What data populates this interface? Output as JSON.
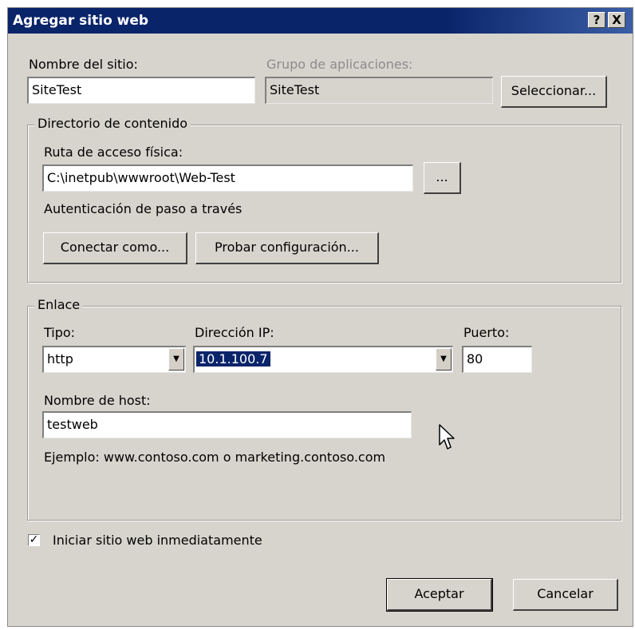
{
  "window": {
    "title": "Agregar sitio web",
    "help_label": "?",
    "close_label": "X"
  },
  "site": {
    "name_label": "Nombre del sitio:",
    "name_value": "SiteTest",
    "app_pool_label": "Grupo de aplicaciones:",
    "app_pool_value": "SiteTest",
    "select_button": "Seleccionar..."
  },
  "content_dir": {
    "group_title": "Directorio de contenido",
    "path_label": "Ruta de acceso física:",
    "path_value": "C:\\inetpub\\wwwroot\\Web-Test",
    "browse_button": "...",
    "auth_text": "Autenticación de paso a través",
    "connect_as_button": "Conectar como...",
    "test_settings_button": "Probar configuración..."
  },
  "binding": {
    "group_title": "Enlace",
    "type_label": "Tipo:",
    "type_value": "http",
    "ip_label": "Dirección IP:",
    "ip_value": "10.1.100.7",
    "port_label": "Puerto:",
    "port_value": "80",
    "host_label": "Nombre de host:",
    "host_value": "testweb",
    "example_text": "Ejemplo: www.contoso.com o marketing.contoso.com"
  },
  "start_now": {
    "checked": true,
    "label": "Iniciar sitio web inmediatamente"
  },
  "footer": {
    "ok_button": "Aceptar",
    "cancel_button": "Cancelar"
  }
}
